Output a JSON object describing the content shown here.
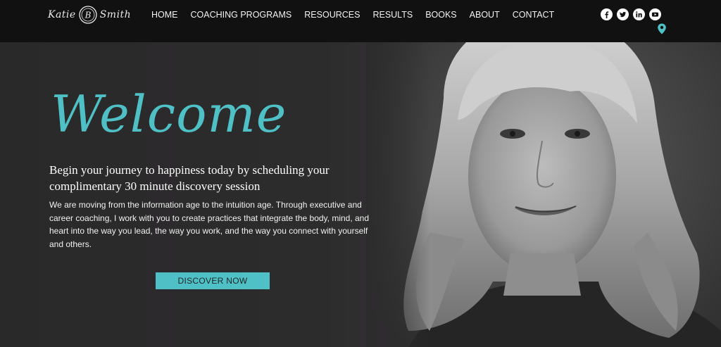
{
  "brand": {
    "logo_first": "Katie",
    "logo_last": "Smith",
    "logo_initial": "B"
  },
  "nav": {
    "items": [
      {
        "label": "HOME"
      },
      {
        "label": "COACHING PROGRAMS"
      },
      {
        "label": "RESOURCES"
      },
      {
        "label": "RESULTS"
      },
      {
        "label": "BOOKS"
      },
      {
        "label": "ABOUT"
      },
      {
        "label": "CONTACT"
      }
    ]
  },
  "social": {
    "icons": [
      "facebook-icon",
      "twitter-icon",
      "linkedin-icon",
      "youtube-icon",
      "location-pin-icon"
    ]
  },
  "hero": {
    "welcome": "Welcome",
    "headline_line1": "Begin your journey to happiness today by scheduling your",
    "headline_line2": "complimentary 30 minute discovery session",
    "body": "We are moving from the information age to the intuition age. Through executive and career coaching, I work with you to create practices that integrate the body, mind, and heart into the way you lead, the way you work, and the way you connect with yourself and others.",
    "cta_label": "DISCOVER NOW"
  },
  "colors": {
    "accent": "#4fc1c6",
    "header_bg": "#111111",
    "hero_bg": "#2b2a2b",
    "text": "#ffffff"
  }
}
